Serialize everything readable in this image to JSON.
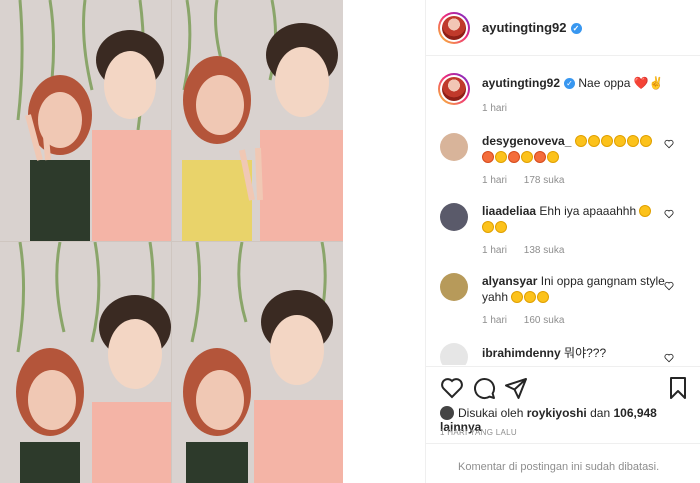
{
  "post": {
    "username": "ayutingting92",
    "verified": true
  },
  "caption": {
    "username": "ayutingting92",
    "text": "Nae oppa",
    "emoji": "❤️✌",
    "time": "1 hari"
  },
  "comments": [
    {
      "username": "desygenoveva_",
      "text": "",
      "emoji_count": 12,
      "time": "1 hari",
      "likes": "178 suka"
    },
    {
      "username": "liaadeliaa",
      "text": "Ehh iya apaaahhh",
      "emoji_count": 3,
      "time": "1 hari",
      "likes": "138 suka"
    },
    {
      "username": "alyansyar",
      "text": "Ini oppa gangnam style yahh",
      "emoji_count": 3,
      "time": "1 hari",
      "likes": "160 suka"
    },
    {
      "username": "ibrahimdenny",
      "text": "뭐야???",
      "time": "",
      "likes": ""
    }
  ],
  "actions": {
    "like_icon": "heart-icon",
    "comment_icon": "comment-icon",
    "share_icon": "paper-plane-icon",
    "save_icon": "bookmark-icon"
  },
  "likes": {
    "prefix": "Disukai oleh",
    "user": "roykiyoshi",
    "middle": "dan",
    "count": "106,948 lainnya"
  },
  "date": "1 HARI YANG LALU",
  "footer": {
    "text": "Komentar di postingan ini sudah dibatasi."
  },
  "colors": {
    "verified": "#3897f0",
    "heart": "#e0245e",
    "muted": "#8e8e8e",
    "text": "#262626"
  }
}
